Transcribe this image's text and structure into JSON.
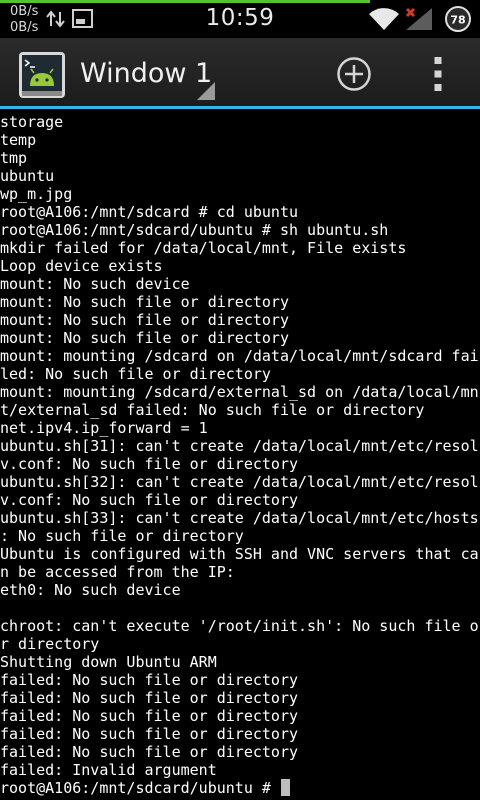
{
  "status_bar": {
    "download_speed": "0B/s",
    "upload_speed": "0B/s",
    "time": "10:59",
    "battery_level": "78",
    "progress_fraction": 0.77
  },
  "action_bar": {
    "window_title": "Window 1",
    "icons": [
      "terminal-app-icon",
      "add-icon",
      "overflow-menu-icon"
    ]
  },
  "terminal": {
    "lines": [
      "storage",
      "temp",
      "tmp",
      "ubuntu",
      "wp_m.jpg",
      "root@A106:/mnt/sdcard # cd ubuntu",
      "root@A106:/mnt/sdcard/ubuntu # sh ubuntu.sh",
      "mkdir failed for /data/local/mnt, File exists",
      "Loop device exists",
      "mount: No such device",
      "mount: No such file or directory",
      "mount: No such file or directory",
      "mount: No such file or directory",
      "mount: mounting /sdcard on /data/local/mnt/sdcard fai",
      "led: No such file or directory",
      "mount: mounting /sdcard/external_sd on /data/local/mn",
      "t/external_sd failed: No such file or directory",
      "net.ipv4.ip_forward = 1",
      "ubuntu.sh[31]: can't create /data/local/mnt/etc/resol",
      "v.conf: No such file or directory",
      "ubuntu.sh[32]: can't create /data/local/mnt/etc/resol",
      "v.conf: No such file or directory",
      "ubuntu.sh[33]: can't create /data/local/mnt/etc/hosts",
      ": No such file or directory",
      "Ubuntu is configured with SSH and VNC servers that ca",
      "n be accessed from the IP:",
      "eth0: No such device",
      "",
      "chroot: can't execute '/root/init.sh': No such file o",
      "r directory",
      "Shutting down Ubuntu ARM",
      "failed: No such file or directory",
      "failed: No such file or directory",
      "failed: No such file or directory",
      "failed: No such file or directory",
      "failed: No such file or directory",
      "failed: Invalid argument"
    ],
    "prompt": "root@A106:/mnt/sdcard/ubuntu # "
  },
  "colors": {
    "accent": "#33b5e5",
    "progress": "#58c02a",
    "terminal_bg": "#000000",
    "terminal_fg": "#ffffff",
    "cursor": "#bdbdbd"
  }
}
